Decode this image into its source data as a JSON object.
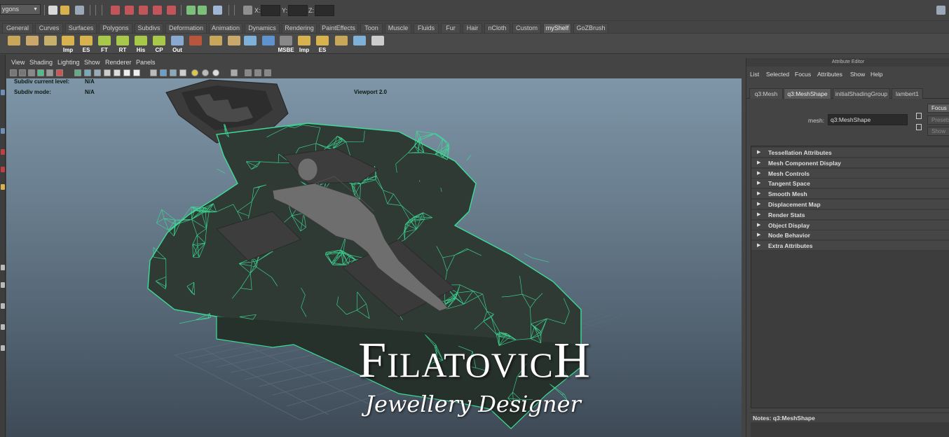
{
  "statusline": {
    "mode": "ygons",
    "x_label": "X:",
    "y_label": "Y:",
    "z_label": "Z:"
  },
  "shelf_tabs": [
    {
      "label": "General"
    },
    {
      "label": "Curves"
    },
    {
      "label": "Surfaces"
    },
    {
      "label": "Polygons"
    },
    {
      "label": "Subdivs"
    },
    {
      "label": "Deformation"
    },
    {
      "label": "Animation"
    },
    {
      "label": "Dynamics"
    },
    {
      "label": "Rendering"
    },
    {
      "label": "PaintEffects"
    },
    {
      "label": "Toon"
    },
    {
      "label": "Muscle"
    },
    {
      "label": "Fluids"
    },
    {
      "label": "Fur"
    },
    {
      "label": "Hair"
    },
    {
      "label": "nCloth"
    },
    {
      "label": "Custom"
    },
    {
      "label": "myShelf",
      "active": true
    },
    {
      "label": "GoZBrush"
    }
  ],
  "shelf_buttons": [
    {
      "icon": "cube-stack-icon",
      "label": "",
      "color": "#c9a75a"
    },
    {
      "icon": "paint-cube-icon",
      "label": "",
      "color": "#caa76a"
    },
    {
      "icon": "grid-cube-icon",
      "label": "",
      "color": "#c7b06a"
    },
    {
      "icon": "folder-import-icon",
      "label": "Imp",
      "color": "#d8b24c"
    },
    {
      "icon": "folder-export-icon",
      "label": "ES",
      "color": "#d8b24c"
    },
    {
      "icon": "axis-icon",
      "label": "FT",
      "color": "#a8c84a"
    },
    {
      "icon": "axis-icon",
      "label": "RT",
      "color": "#a8c84a"
    },
    {
      "icon": "axis-icon",
      "label": "His",
      "color": "#a8c84a"
    },
    {
      "icon": "axis-icon",
      "label": "CP",
      "color": "#a8c84a"
    },
    {
      "icon": "window-icon",
      "label": "Out",
      "color": "#8aa9d0"
    },
    {
      "icon": "frame-icon",
      "label": "",
      "color": "#b8553c"
    },
    {
      "icon": "cube-icon",
      "label": "",
      "color": "#c9a75a"
    },
    {
      "icon": "plane-icon",
      "label": "",
      "color": "#caa76a"
    },
    {
      "icon": "lattice-icon",
      "label": "",
      "color": "#7fb0d8"
    },
    {
      "icon": "bend-icon",
      "label": "",
      "color": "#5f93d0"
    },
    {
      "icon": "mesh-icon",
      "label": "MSBE",
      "color": "#888"
    },
    {
      "icon": "folder-import-icon",
      "label": "Imp",
      "color": "#d8b24c"
    },
    {
      "icon": "folder-export-icon",
      "label": "ES",
      "color": "#d8b24c"
    },
    {
      "icon": "sphere-icon",
      "label": "",
      "color": "#c9a75a"
    },
    {
      "icon": "curve-icon",
      "label": "",
      "color": "#7fb0d8"
    },
    {
      "icon": "brush-icon",
      "label": "",
      "color": "#ccc"
    }
  ],
  "viewport": {
    "menus": [
      "View",
      "Shading",
      "Lighting",
      "Show",
      "Renderer",
      "Panels"
    ],
    "hud": {
      "subdiv_level_label": "Subdiv current level:",
      "subdiv_level_value": "N/A",
      "subdiv_mode_label": "Subdiv mode:",
      "subdiv_mode_value": "N/A",
      "renderer": "Viewport 2.0"
    }
  },
  "logo": {
    "title": "FilatovicH",
    "subtitle": "Jewellery Designer"
  },
  "attribute_editor": {
    "title": "Attribute Editor",
    "menus": [
      "List",
      "Selected",
      "Focus",
      "Attributes",
      "Show",
      "Help"
    ],
    "tabs": [
      {
        "label": "q3:Mesh"
      },
      {
        "label": "q3:MeshShape",
        "active": true
      },
      {
        "label": "initialShadingGroup"
      },
      {
        "label": "lambert1"
      }
    ],
    "mesh_label": "mesh:",
    "mesh_value": "q3:MeshShape",
    "focus_button": "Focus",
    "presets_button": "Presets",
    "show_button": "Show",
    "sections": [
      "Tessellation Attributes",
      "Mesh Component Display",
      "Mesh Controls",
      "Tangent Space",
      "Smooth Mesh",
      "Displacement Map",
      "Render Stats",
      "Object Display",
      "Node Behavior",
      "Extra Attributes"
    ],
    "notes": "Notes:  q3:MeshShape"
  },
  "colors": {
    "wireframe": "#3ddc97",
    "viewport_top": "#7e96a8",
    "viewport_bottom": "#3e4a56",
    "ui_bg": "#444444"
  }
}
